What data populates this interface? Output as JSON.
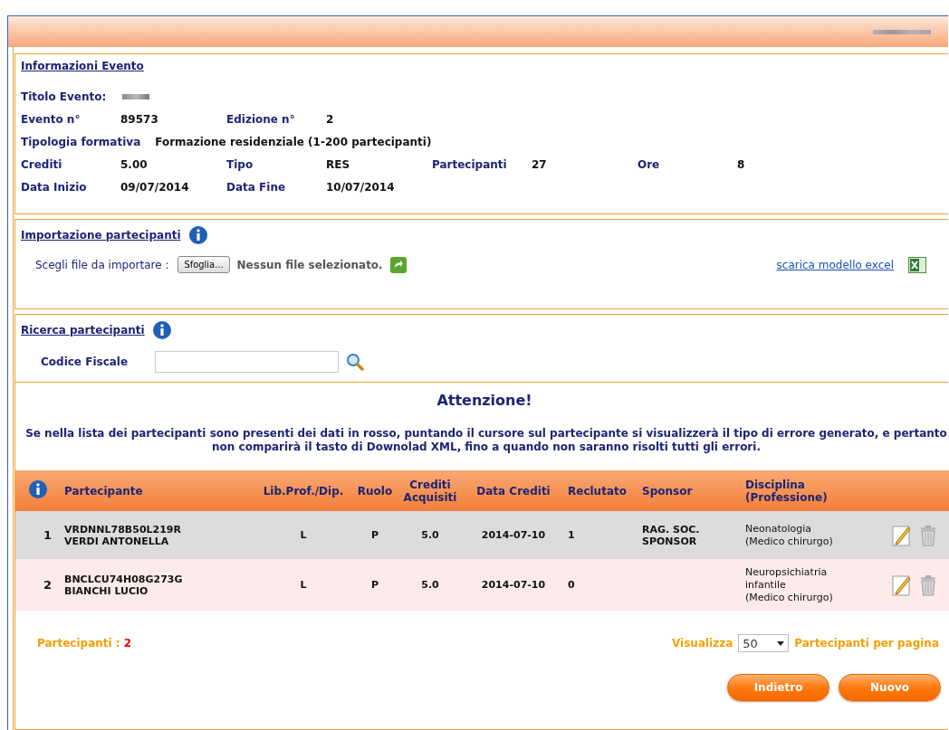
{
  "event_info": {
    "heading": "Informazioni Evento",
    "title_label": "Titolo Evento:",
    "rows": [
      [
        {
          "label": "Evento n°",
          "value": "89573"
        },
        {
          "label": "Edizione n°",
          "value": "2"
        }
      ],
      [
        {
          "label": "Tipologia formativa",
          "value": "Formazione residenziale (1-200 partecipanti)"
        }
      ],
      [
        {
          "label": "Crediti",
          "value": "5.00"
        },
        {
          "label": "Tipo",
          "value": "RES"
        },
        {
          "label": "Partecipanti",
          "value": "27"
        },
        {
          "label": "Ore",
          "value": "8"
        }
      ],
      [
        {
          "label": "Data Inizio",
          "value": "09/07/2014"
        },
        {
          "label": "Data Fine",
          "value": "10/07/2014"
        }
      ]
    ]
  },
  "import": {
    "heading": "Importazione partecipanti",
    "file_label": "Scegli file da importare :",
    "browse_button": "Sfoglia...",
    "file_status": "Nessun file selezionato.",
    "template_link": "scarica modello excel"
  },
  "search": {
    "heading": "Ricerca partecipanti",
    "field_label": "Codice Fiscale"
  },
  "warning": {
    "title": "Attenzione!",
    "message": "Se nella lista dei partecipanti sono presenti dei dati in rosso, puntando il cursore sul partecipante si visualizzerà il tipo di errore generato, e pertanto non comparirà il tasto di Downolad XML, fino a quando non saranno risolti tutti gli errori."
  },
  "table": {
    "columns": [
      "Partecipante",
      "Lib.Prof./Dip.",
      "Ruolo",
      "Crediti Acquisiti",
      "Data Crediti",
      "Reclutato",
      "Sponsor",
      "Disciplina (Professione)"
    ],
    "rows": [
      {
        "number": "1",
        "code": "VRDNNL78B50L219R",
        "name": "VERDI ANTONELLA",
        "employment": "L",
        "role": "P",
        "credits": "5.0",
        "credit_date": "2014-07-10",
        "recruited": "1",
        "sponsor": "RAG. SOC. SPONSOR",
        "discipline": "Neonatologia",
        "profession": "(Medico chirurgo)",
        "selected": true
      },
      {
        "number": "2",
        "code": "BNCLCU74H08G273G",
        "name": "BIANCHI LUCIO",
        "employment": "L",
        "role": "P",
        "credits": "5.0",
        "credit_date": "2014-07-10",
        "recruited": "0",
        "discipline": "Neuropsichiatria infantile",
        "profession": "(Medico chirurgo)",
        "selected": false
      }
    ]
  },
  "footer": {
    "count_label": "Partecipanti :",
    "count": "2",
    "per_page_label": "Visualizza",
    "per_page": "50",
    "per_page_suffix": "Partecipanti per pagina",
    "buttons": [
      "Indietro",
      "Nuovo"
    ]
  }
}
